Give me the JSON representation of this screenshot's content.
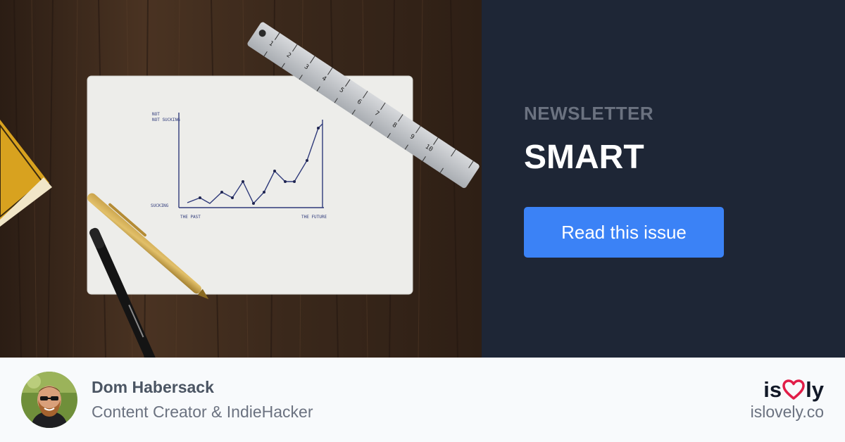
{
  "panel": {
    "kicker": "NEWSLETTER",
    "title": "SMART",
    "cta_label": "Read this issue",
    "background": "#1e2636",
    "accent": "#3b82f6"
  },
  "photo": {
    "chart_labels": {
      "y_top": "NOT SUCKING",
      "y_bottom": "SUCKING",
      "x_left": "THE PAST",
      "x_right": "THE FUTURE"
    }
  },
  "author": {
    "name": "Dom Habersack",
    "role": "Content Creator & IndieHacker"
  },
  "brand": {
    "logo_left": "is",
    "logo_right": "ly",
    "logo_icon": "heart-icon",
    "domain": "islovely.co",
    "heart_color": "#e11d48"
  }
}
